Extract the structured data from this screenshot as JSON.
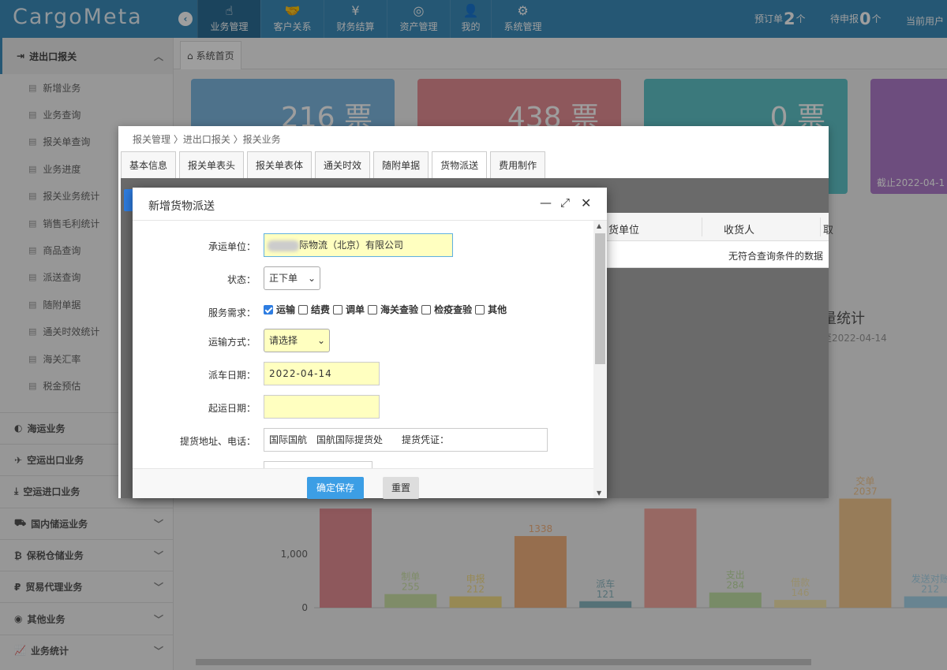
{
  "app": {
    "logo": "CargoMeta",
    "collapse_icon": "‹"
  },
  "nav": [
    {
      "label": "业务管理",
      "icon": "☝",
      "active": true
    },
    {
      "label": "客户关系",
      "icon": "🤝",
      "active": false
    },
    {
      "label": "财务结算",
      "icon": "¥",
      "active": false
    },
    {
      "label": "资产管理",
      "icon": "◎",
      "active": false
    },
    {
      "label": "我的",
      "icon": "👤",
      "active": false
    },
    {
      "label": "系统管理",
      "icon": "⚙",
      "active": false
    }
  ],
  "top_stats": {
    "pre_label": "预订单",
    "pre_value": "2",
    "pre_unit": "个",
    "pending_label": "待申报",
    "pending_value": "0",
    "pending_unit": "个",
    "current_user": "当前用户"
  },
  "sidebar": {
    "head": "进出口报关",
    "items": [
      "新增业务",
      "业务查询",
      "报关单查询",
      "业务进度",
      "报关业务统计",
      "销售毛利统计",
      "商品查询",
      "派送查询",
      "随附单据",
      "通关时效统计",
      "海关汇率",
      "税金预估"
    ],
    "groups": [
      {
        "label": "海运业务",
        "icon": "◐",
        "chev": false
      },
      {
        "label": "空运出口业务",
        "icon": "✈",
        "chev": false
      },
      {
        "label": "空运进口业务",
        "icon": "⤓",
        "chev": false
      },
      {
        "label": "国内储运业务",
        "icon": "⛟",
        "chev": true
      },
      {
        "label": "保税仓储业务",
        "icon": "₿",
        "chev": true
      },
      {
        "label": "贸易代理业务",
        "icon": "₽",
        "chev": true
      },
      {
        "label": "其他业务",
        "icon": "◉",
        "chev": true
      },
      {
        "label": "业务统计",
        "icon": "📈",
        "chev": true
      }
    ]
  },
  "main_tab": "系统首页",
  "cards": [
    {
      "value": "216 票",
      "color": "#7fb8e0",
      "sub": ""
    },
    {
      "value": "438 票",
      "color": "#e58f95",
      "sub": ""
    },
    {
      "value": "0 票",
      "color": "#5fc4c8",
      "sub": ""
    },
    {
      "value": "",
      "color": "#b07ccc",
      "sub": "截止2022-04-1"
    }
  ],
  "chart_title": "量统计",
  "chart_subtitle": "至2022-04-14",
  "chart_data": {
    "type": "bar",
    "ylim": [
      0,
      2100
    ],
    "yticks": [
      0,
      1000
    ],
    "ytick_labels": [
      "0",
      "1,000"
    ],
    "categories": [
      "",
      "制单",
      "申报",
      "",
      "派车",
      "",
      "支出",
      "借款",
      "交单",
      "发送对账"
    ],
    "values": [
      1850,
      255,
      212,
      1338,
      121,
      1850,
      284,
      146,
      2037,
      212
    ],
    "colors": [
      "#e58f95",
      "#cde3a8",
      "#f4dd88",
      "#f2b27e",
      "#8ab6c0",
      "#f4a9a0",
      "#c2e0a6",
      "#f6e7b0",
      "#f4c890",
      "#a8d6ea"
    ],
    "value_labels": [
      "",
      "255",
      "212",
      "1338",
      "121",
      "",
      "284",
      "146",
      "2037",
      "212"
    ]
  },
  "window": {
    "breadcrumb": "报关管理 〉进出口报关 〉报关业务",
    "tabs": [
      "基本信息",
      "报关单表头",
      "报关单表体",
      "通关时效",
      "随附单据",
      "货物派送",
      "费用制作"
    ],
    "active_tab": 5,
    "table_headers": [
      "货单位",
      "收货人",
      "取"
    ],
    "empty_text": "无符合查询条件的数据"
  },
  "dialog": {
    "title": "新增货物派送",
    "minimize_icon": "—",
    "maximize_icon": "⤢",
    "close_icon": "✕",
    "carrier_label": "承运单位：",
    "carrier_value": "际物流（北京）有限公司",
    "status_label": "状态：",
    "status_value": "正下单",
    "service_label": "服务需求：",
    "services": [
      {
        "label": "运输",
        "checked": true
      },
      {
        "label": "结费",
        "checked": false
      },
      {
        "label": "调单",
        "checked": false
      },
      {
        "label": "海关查验",
        "checked": false
      },
      {
        "label": "检疫查验",
        "checked": false
      },
      {
        "label": "其他",
        "checked": false
      }
    ],
    "transport_label": "运输方式：",
    "transport_value": "请选择",
    "dispatch_date_label": "派车日期：",
    "dispatch_date_value": "2022-04-14",
    "start_date_label": "起运日期：",
    "start_date_value": "",
    "pickup_label": "提货地址、电话：",
    "pickup_value": "国际国航　国航国际提货处　　提货凭证：",
    "save_button": "确定保存",
    "reset_button": "重置"
  }
}
